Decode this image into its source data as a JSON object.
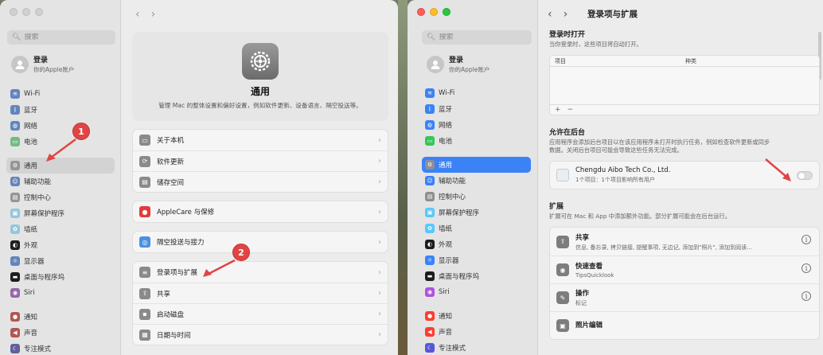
{
  "left_window": {
    "search": {
      "placeholder": "搜索"
    },
    "account": {
      "name": "登录",
      "subtitle": "你的Apple账户"
    },
    "sidebar": [
      {
        "label": "Wi-Fi",
        "icon": "wifi-icon",
        "color": "#3b82f6"
      },
      {
        "label": "蓝牙",
        "icon": "bluetooth-icon",
        "color": "#3b82f6"
      },
      {
        "label": "网络",
        "icon": "globe-icon",
        "color": "#3b82f6"
      },
      {
        "label": "电池",
        "icon": "battery-icon",
        "color": "#34c759"
      },
      {
        "label": "通用",
        "icon": "gear-icon",
        "color": "#8e8e93",
        "selected": true
      },
      {
        "label": "辅助功能",
        "icon": "accessibility-icon",
        "color": "#3b82f6"
      },
      {
        "label": "控制中心",
        "icon": "control-center-icon",
        "color": "#8e8e93"
      },
      {
        "label": "屏幕保护程序",
        "icon": "screensaver-icon",
        "color": "#5ac8fa"
      },
      {
        "label": "墙纸",
        "icon": "wallpaper-icon",
        "color": "#5ac8fa"
      },
      {
        "label": "外观",
        "icon": "appearance-icon",
        "color": "#1c1c1e"
      },
      {
        "label": "显示器",
        "icon": "display-icon",
        "color": "#3b82f6"
      },
      {
        "label": "桌面与程序坞",
        "icon": "dock-icon",
        "color": "#1c1c1e"
      },
      {
        "label": "Siri",
        "icon": "siri-icon",
        "color": "#af52de"
      },
      {
        "label": "通知",
        "icon": "bell-icon",
        "color": "#ff3b30"
      },
      {
        "label": "声音",
        "icon": "speaker-icon",
        "color": "#ff3b30"
      },
      {
        "label": "专注模式",
        "icon": "moon-icon",
        "color": "#5856d6"
      }
    ],
    "hero": {
      "title": "通用",
      "description": "管理 Mac 的整体设置和偏好设置，例如软件更新、设备语言、隔空投送等。"
    },
    "groups": [
      [
        {
          "label": "关于本机",
          "icon": "laptop-icon"
        },
        {
          "label": "软件更新",
          "icon": "update-gear-icon"
        },
        {
          "label": "储存空间",
          "icon": "storage-icon"
        }
      ],
      [
        {
          "label": "AppleCare 与保修",
          "icon": "apple-icon"
        }
      ],
      [
        {
          "label": "隔空投送与接力",
          "icon": "airdrop-icon"
        }
      ],
      [
        {
          "label": "登录项与扩展",
          "icon": "list-icon"
        },
        {
          "label": "共享",
          "icon": "share-icon"
        },
        {
          "label": "启动磁盘",
          "icon": "disk-icon"
        },
        {
          "label": "日期与时间",
          "icon": "calendar-icon"
        }
      ]
    ],
    "badges": [
      "1",
      "2"
    ]
  },
  "right_window": {
    "title": "登录项与扩展",
    "search": {
      "placeholder": "搜索"
    },
    "account": {
      "name": "登录",
      "subtitle": "你的Apple账户"
    },
    "sidebar_labels": [
      "Wi-Fi",
      "蓝牙",
      "网络",
      "电池",
      "通用",
      "辅助功能",
      "控制中心",
      "屏幕保护程序",
      "墙纸",
      "外观",
      "显示器",
      "桌面与程序坞",
      "Siri",
      "通知",
      "声音",
      "专注模式"
    ],
    "login_items": {
      "title": "登录时打开",
      "description": "当你登录时，这些项目将自动打开。",
      "col_item": "项目",
      "col_kind": "种类",
      "add": "+",
      "remove": "−"
    },
    "background": {
      "title": "允许在后台",
      "description1": "应用程序会添加后台项目以在该应用程序未打开时执行任务，例如检查软件更新或同步",
      "description2": "数据。关闭后台项目可能会导致这些任务无法完成。",
      "app_name": "Chengdu Aibo Tech Co., Ltd.",
      "app_sub": "1个项目：1个项目影响所有用户"
    },
    "extensions": {
      "title": "扩展",
      "description": "扩展可在 Mac 和 App 中添加额外功能。部分扩展可能会在后台运行。",
      "items": [
        {
          "name": "共享",
          "sub": "信息, 备忘录, 拷贝链接, 提醒事项, 无边记, 添加到\"照片\", 添加到阅读...",
          "icon": "share-icon"
        },
        {
          "name": "快速查看",
          "sub": "TipsQuicklook",
          "icon": "eye-icon"
        },
        {
          "name": "操作",
          "sub": "标记",
          "icon": "action-icon"
        },
        {
          "name": "照片编辑",
          "sub": "",
          "icon": "photo-icon"
        }
      ],
      "info": "i"
    }
  }
}
